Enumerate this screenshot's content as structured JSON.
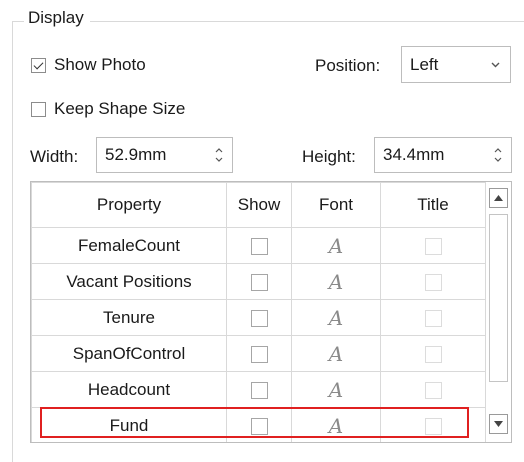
{
  "group": {
    "title": "Display"
  },
  "show_photo": {
    "label": "Show Photo",
    "checked": true
  },
  "position": {
    "label": "Position:",
    "value": "Left",
    "chevron_icon": "chevron-down-icon"
  },
  "keep_shape": {
    "label": "Keep Shape Size",
    "checked": false
  },
  "width": {
    "label": "Width:",
    "value": "52.9mm"
  },
  "height": {
    "label": "Height:",
    "value": "34.4mm"
  },
  "table": {
    "headers": [
      "Property",
      "Show",
      "Font",
      "Title"
    ],
    "font_glyph": "A",
    "rows": [
      {
        "property": "FemaleCount"
      },
      {
        "property": "Vacant Positions"
      },
      {
        "property": "Tenure"
      },
      {
        "property": "SpanOfControl"
      },
      {
        "property": "Headcount"
      },
      {
        "property": "Fund"
      }
    ]
  },
  "highlight_color": "#e02020"
}
